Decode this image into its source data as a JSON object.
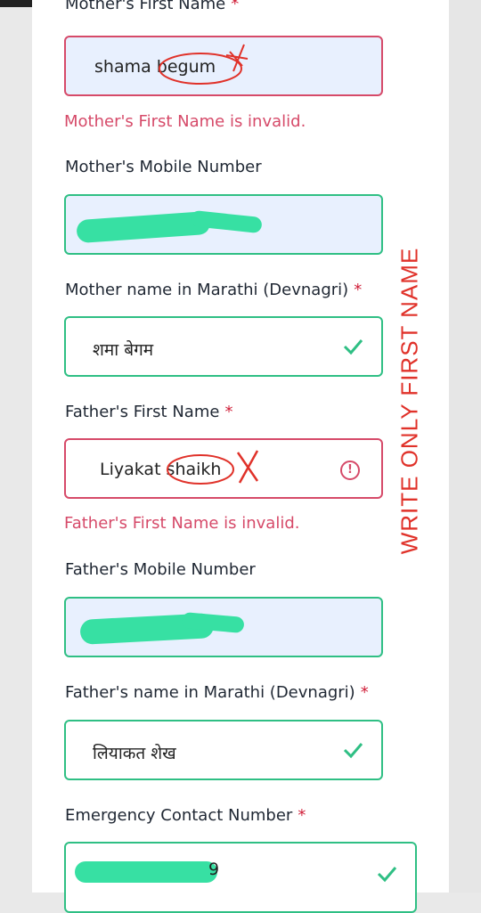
{
  "mother_first_name": {
    "label": "Mother's First Name",
    "required": "*",
    "value": "shama begum",
    "error": "Mother's First Name is invalid."
  },
  "mother_mobile": {
    "label": "Mother's Mobile Number"
  },
  "mother_marathi": {
    "label": "Mother name in Marathi (Devnagri)",
    "required": "*",
    "value": "शमा बेगम"
  },
  "father_first_name": {
    "label": "Father's First Name",
    "required": "*",
    "value": "Liyakat shaikh",
    "error": "Father's First Name is invalid."
  },
  "father_mobile": {
    "label": "Father's Mobile Number"
  },
  "father_marathi": {
    "label": "Father's name in Marathi (Devnagri)",
    "required": "*",
    "value": "लियाकत शेख"
  },
  "emergency": {
    "label": "Emergency Contact Number",
    "required": "*",
    "value_tail": "9"
  },
  "annotation": {
    "text": "WRITE ONLY FIRST NAME"
  },
  "colors": {
    "valid": "#2fbf84",
    "invalid": "#d64a69",
    "autofill": "#e8f0fe",
    "annotation": "#e0322a"
  }
}
